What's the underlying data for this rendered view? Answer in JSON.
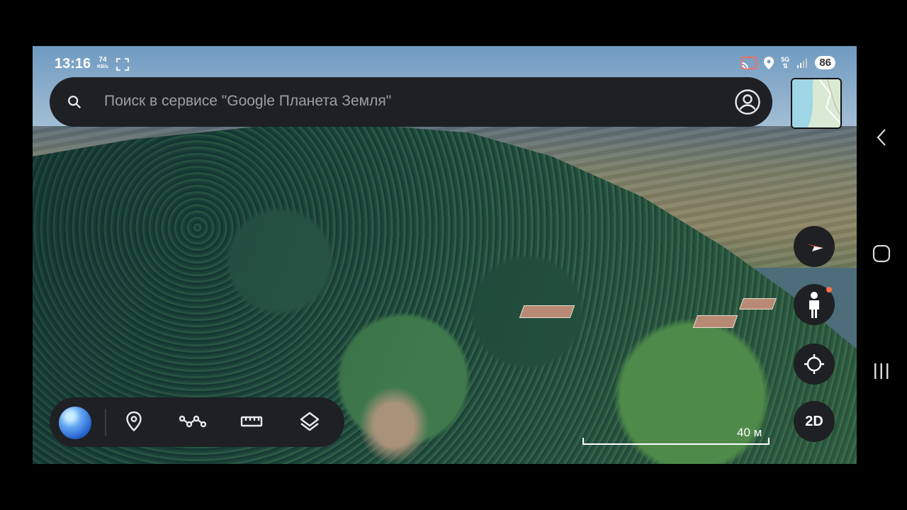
{
  "status_bar": {
    "time": "13:16",
    "net_speed_value": "74",
    "net_speed_unit": "KB/s",
    "network_type": "5G",
    "battery": "86"
  },
  "search": {
    "placeholder": "Поиск в сервисе \"Google Планета Земля\""
  },
  "map": {
    "scale_label": "40 м",
    "view_mode_button": "2D"
  },
  "toolbar": {
    "items": [
      "globe-icon",
      "place-pin-icon",
      "path-icon",
      "ruler-icon",
      "layers-icon"
    ]
  },
  "right_controls": [
    "compass-icon",
    "street-view-pegman-icon",
    "my-location-icon"
  ],
  "android_nav": [
    "back-icon",
    "home-icon",
    "recents-icon"
  ],
  "colors": {
    "panel": "#1f2023",
    "placeholder_text": "#9aa0a6",
    "compass_red": "#e53935",
    "notification_dot": "#ff7043"
  }
}
